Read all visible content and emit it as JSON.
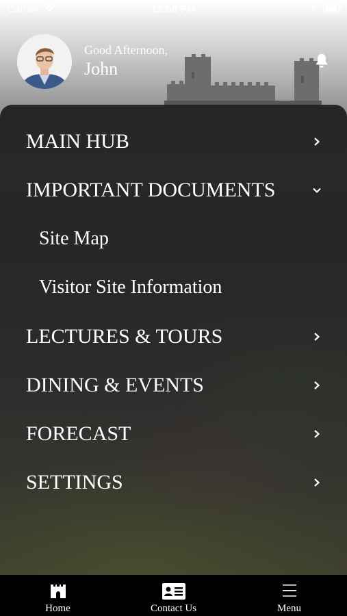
{
  "status_bar": {
    "carrier": "Carrier",
    "time": "12:08 PM",
    "icons": [
      "wifi-icon",
      "location-arrow-icon",
      "battery-icon"
    ]
  },
  "header": {
    "greeting": "Good Afternoon,",
    "user_name": "John",
    "avatar": "user-avatar-photo",
    "notification_icon": "bell-icon",
    "background_image": "castle-battlements"
  },
  "menu": {
    "items": [
      {
        "label": "MAIN HUB",
        "chevron": "chevron-right-icon",
        "level": 0
      },
      {
        "label": "IMPORTANT DOCUMENTS",
        "chevron": "chevron-down-icon",
        "level": 0,
        "expanded": true
      },
      {
        "label": "Site Map",
        "level": 1
      },
      {
        "label": "Visitor Site Information",
        "level": 1
      },
      {
        "label": "LECTURES & TOURS",
        "chevron": "chevron-right-icon",
        "level": 0
      },
      {
        "label": "DINING & EVENTS",
        "chevron": "chevron-right-icon",
        "level": 0
      },
      {
        "label": "FORECAST",
        "chevron": "chevron-right-icon",
        "level": 0
      },
      {
        "label": "SETTINGS",
        "chevron": "chevron-right-icon",
        "level": 0
      }
    ]
  },
  "tab_bar": {
    "tabs": [
      {
        "label": "Home",
        "icon": "castle-icon"
      },
      {
        "label": "Contact Us",
        "icon": "contact-card-icon"
      },
      {
        "label": "Menu",
        "icon": "hamburger-menu-icon"
      }
    ]
  },
  "colors": {
    "text": "#ffffff",
    "panel": "#262626",
    "tab_bar": "#000000"
  }
}
